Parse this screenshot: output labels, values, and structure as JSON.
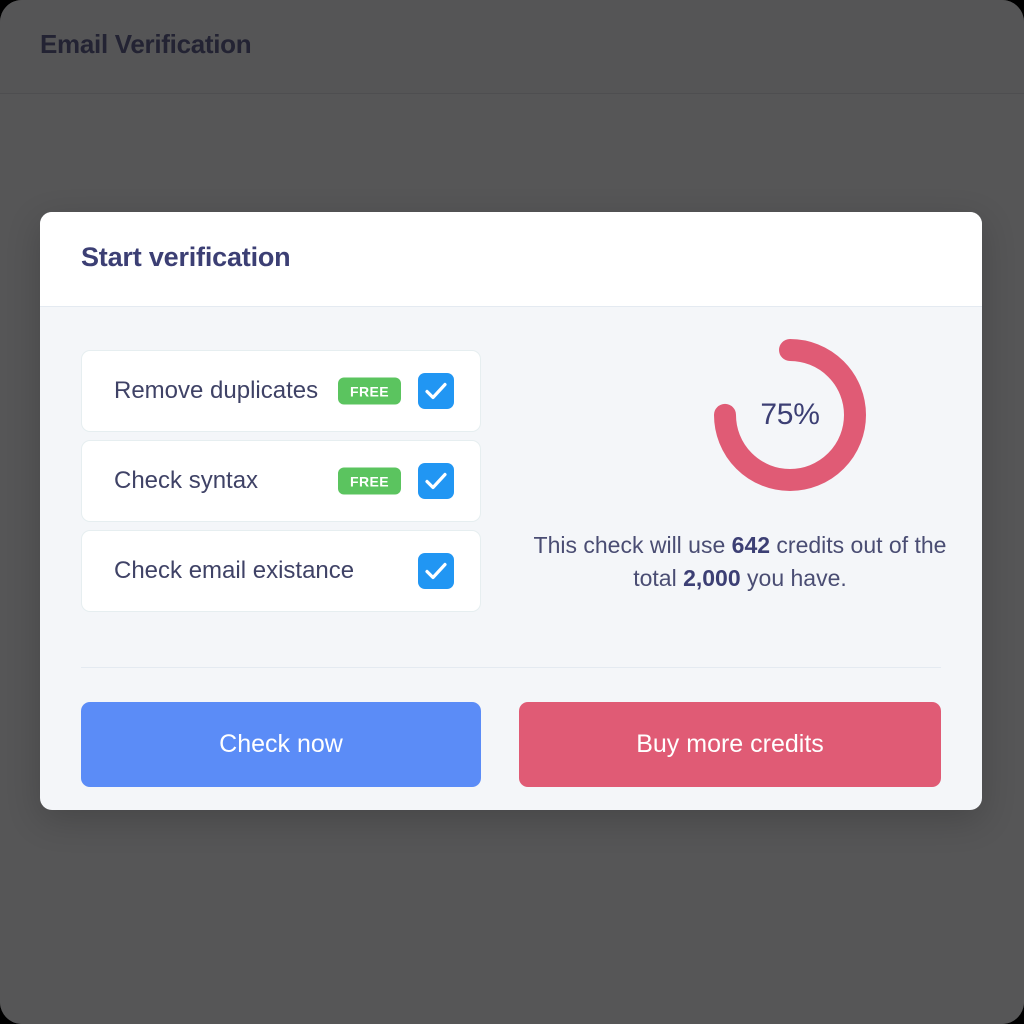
{
  "topbar": {
    "title": "Email Verification"
  },
  "card": {
    "title": "Start verification",
    "checklist": [
      {
        "label": "Remove duplicates",
        "badge": "FREE",
        "checked": true
      },
      {
        "label": "Check syntax",
        "badge": "FREE",
        "checked": true
      },
      {
        "label": "Check email existance",
        "badge": "",
        "checked": true
      }
    ],
    "progress": {
      "value_label": "75%",
      "percent": 75,
      "track_color": "#f4f6f9",
      "arc_color": "#e05b75"
    },
    "credits": {
      "prefix": "This check will use ",
      "used": "642",
      "middle": " credits out of the total ",
      "total": "2,000",
      "suffix": " you have."
    },
    "buttons": {
      "primary_label": "Check now",
      "primary_color": "#5b8cf7",
      "secondary_label": "Buy more credits",
      "secondary_color": "#e05b75"
    }
  },
  "colors": {
    "page_background": "#565657",
    "card_body": "#f4f6f9",
    "badge_green": "#5bc45f",
    "checkbox_blue": "#2196f3",
    "heading_indigo": "#3c3f74"
  }
}
